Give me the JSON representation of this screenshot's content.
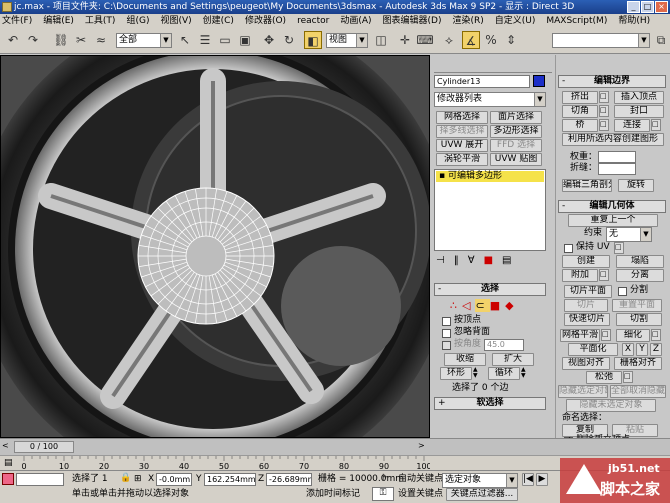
{
  "window": {
    "title": "jc.max  - 项目文件夹: C:\\Documents and Settings\\peugeot\\My Documents\\3dsmax  - Autodesk 3ds Max 9 SP2  - 显示 : Direct 3D"
  },
  "menu": [
    "文件(F)",
    "编辑(E)",
    "工具(T)",
    "组(G)",
    "视图(V)",
    "创建(C)",
    "修改器(O)",
    "reactor",
    "动画(A)",
    "图表编辑器(D)",
    "渲染(R)",
    "自定义(U)",
    "MAXScript(M)",
    "帮助(H)"
  ],
  "toolbar": {
    "selection_filter": "全部",
    "coord_system": "视图"
  },
  "modify_panel": {
    "object_name": "Cylinder13",
    "modifier_list": "修改器列表",
    "quick_buttons": [
      [
        "网格选择",
        "面片选择"
      ],
      [
        "择多线选择",
        "多边形选择"
      ],
      [
        "UVW 展开",
        "FFD 选择"
      ],
      [
        "涡轮平滑",
        "UVW 贴图"
      ]
    ],
    "stack_item": "可编辑多边形",
    "selection_rollout": "选择",
    "by_vertex": "按顶点",
    "ignore_backfacing": "忽略背面",
    "by_angle": "按角度",
    "angle_value": "45.0",
    "shrink": "收缩",
    "grow": "扩大",
    "ring": "环形",
    "loop": "循环",
    "selected_count": "选择了 0 个边",
    "soft_selection": "软选择"
  },
  "edit_panel": {
    "edit_edges": "编辑边界",
    "extrude": "挤出",
    "insert_vertex": "插入顶点",
    "chamfer": "切角",
    "cap": "封口",
    "bridge": "桥",
    "connect": "连接",
    "create_shape": "利用所选内容创建图形",
    "weight": "权重：",
    "crease": "折缝：",
    "edit_tris": "编辑三角剖分",
    "turn": "旋转",
    "edit_geometry": "编辑几何体",
    "repeat_last": "重复上一个",
    "constraints": "约束",
    "constraints_value": "无",
    "preserve_uvs": "保持 UV",
    "create": "创建",
    "collapse": "塌陷",
    "attach": "附加",
    "detach": "分离",
    "slice_plane": "切片平面",
    "split": "分割",
    "slice": "切片",
    "reset_plane": "重置平面",
    "quickslice": "快速切片",
    "cut": "切割",
    "meshsmooth": "网格平滑",
    "tessellate": "细化",
    "make_planar": "平面化",
    "xyz": [
      "X",
      "Y",
      "Z"
    ],
    "view_align": "视图对齐",
    "grid_align": "栅格对齐",
    "relax": "松弛",
    "hide_selected": "隐藏选定对象",
    "unhide_all": "全部取消隐藏",
    "hide_unselected": "隐藏未选定对象",
    "named_sel": "命名选择：",
    "copy": "复制",
    "paste": "粘贴",
    "delete_isolated": "删除孤立顶点"
  },
  "timeline": {
    "frame": "0 / 100"
  },
  "track_ticks": [
    "0",
    "10",
    "20",
    "30",
    "40",
    "50",
    "60",
    "70",
    "80",
    "90",
    "100"
  ],
  "status": {
    "selected": "选择了 1",
    "x_value": "-0.0mm",
    "y_value": "162.254mm",
    "z_value": "-26.689mm",
    "grid": "栅格 = 10000.0mm",
    "auto_key": "自动关键点",
    "selected_obj": "选定对象",
    "set_key": "设置关键点",
    "key_filter": "关键点过滤器...",
    "prompt": "单击或单击并拖动以选择对象",
    "add_tag": "添加时间标记"
  },
  "watermark": {
    "site": "jb51.net",
    "name": "脚本之家"
  },
  "colors": {
    "accent": "#f2d26a",
    "title": "#2b5fb5",
    "wire": "#ffffff"
  }
}
